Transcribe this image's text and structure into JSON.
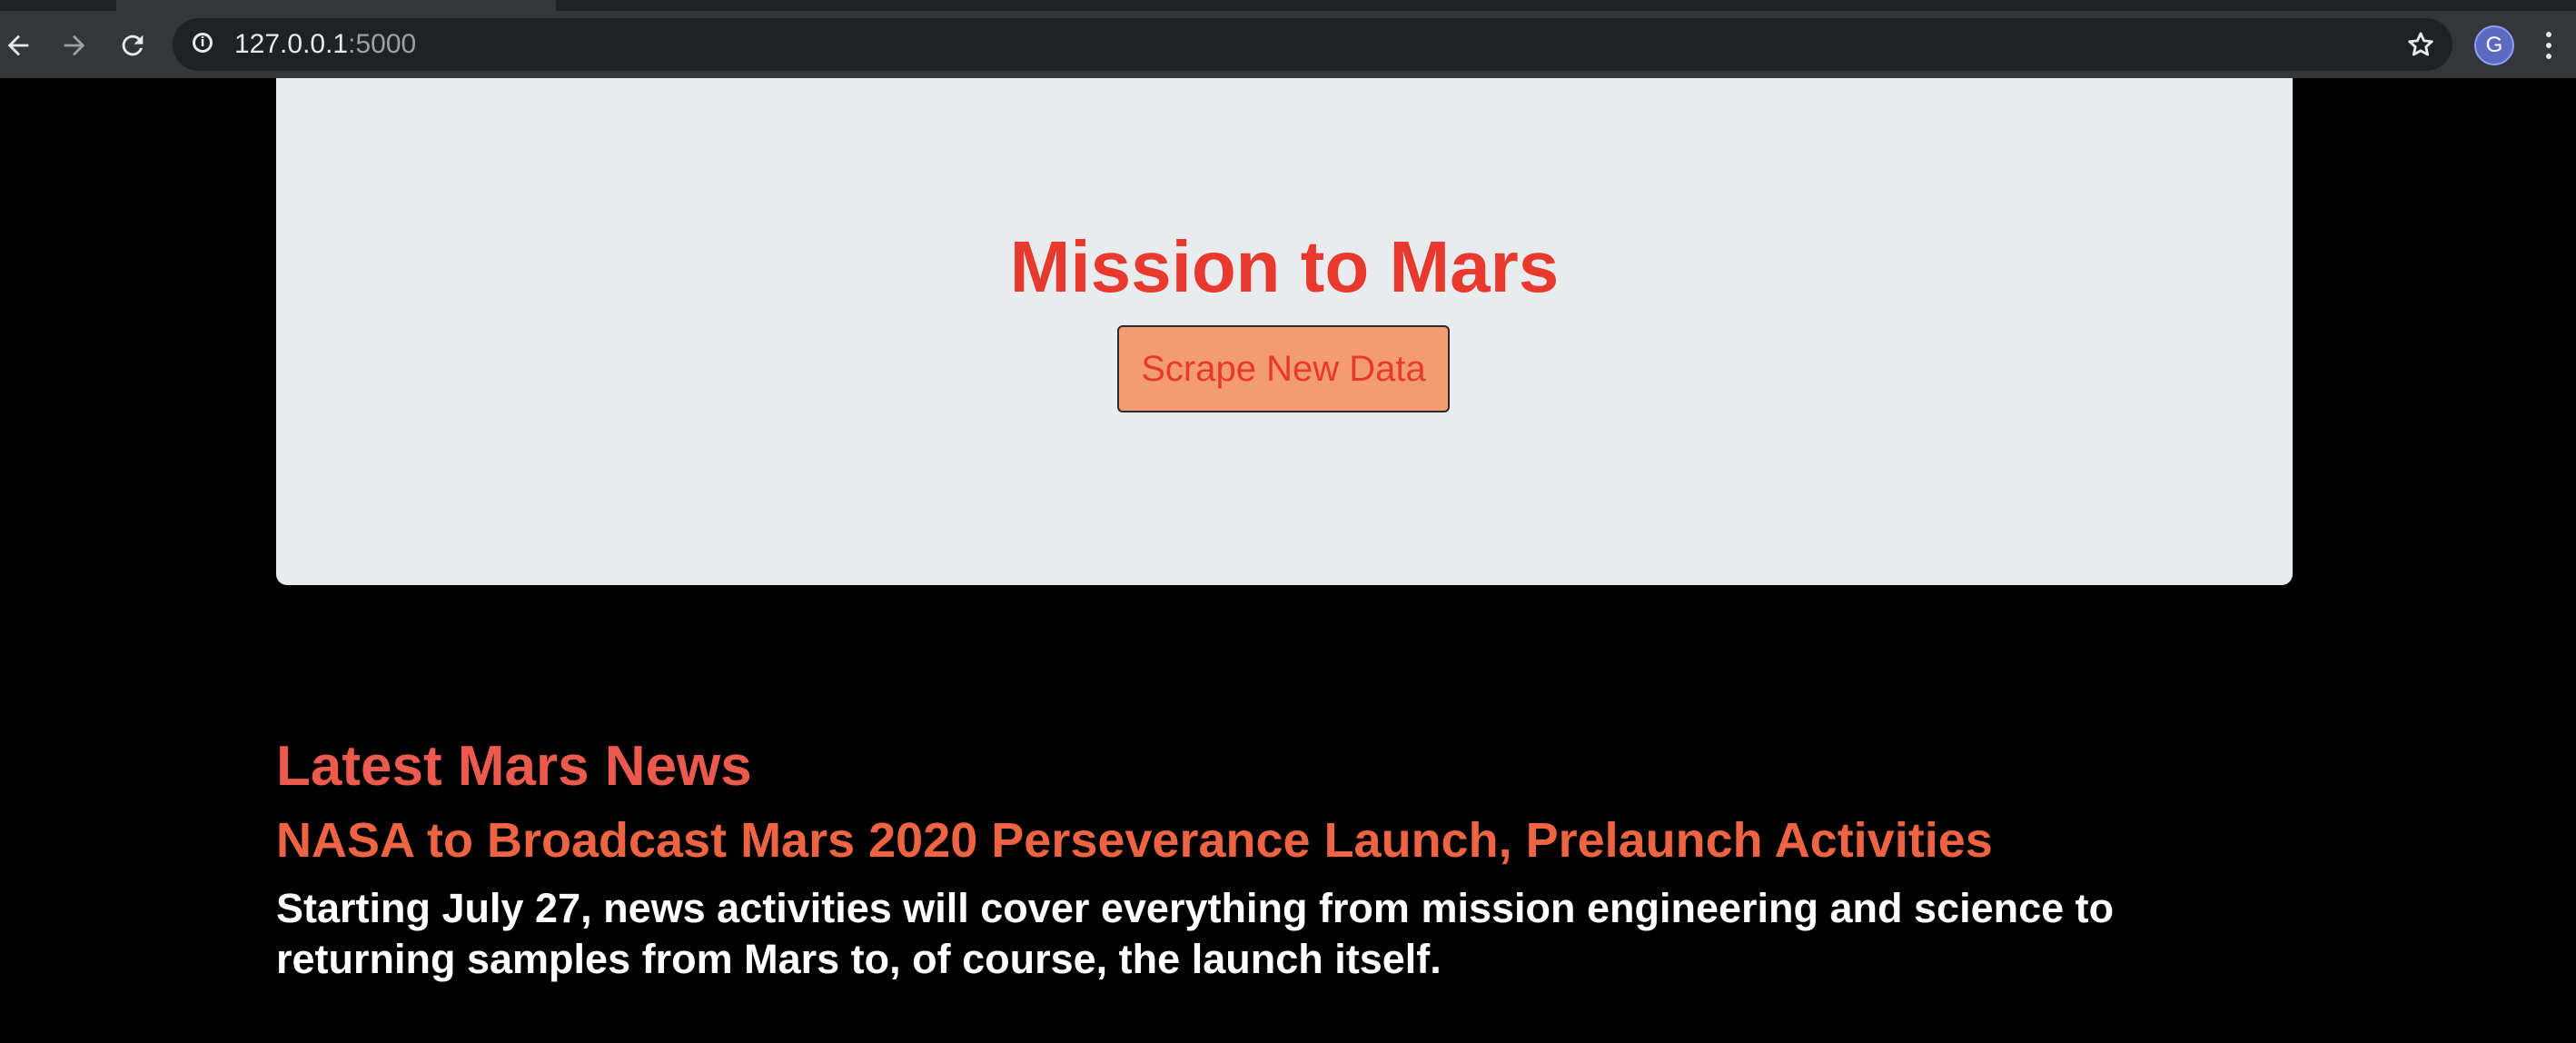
{
  "browser": {
    "url_host": "127.0.0.1",
    "url_port": ":5000",
    "avatar_letter": "G",
    "icons": {
      "back": "arrow-left-icon",
      "forward": "arrow-right-icon",
      "reload": "reload-icon",
      "info": "info-icon",
      "bookmark": "star-icon",
      "menu": "kebab-menu-icon"
    }
  },
  "jumbotron": {
    "title": "Mission to Mars",
    "button_label": "Scrape New Data"
  },
  "news": {
    "heading": "Latest Mars News",
    "title": "NASA to Broadcast Mars 2020 Perseverance Launch, Prelaunch Activities",
    "teaser": "Starting July 27, news activities will cover everything from mission engineering and science to returning samples from Mars to, of course, the launch itself."
  },
  "colors": {
    "title_red": "#e8392f",
    "button_bg": "#f39c72",
    "heading_coral": "#ec5a4e",
    "news_title_orange": "#ee6442",
    "jumbotron_bg": "#e9ecef",
    "page_bg": "#000000"
  }
}
